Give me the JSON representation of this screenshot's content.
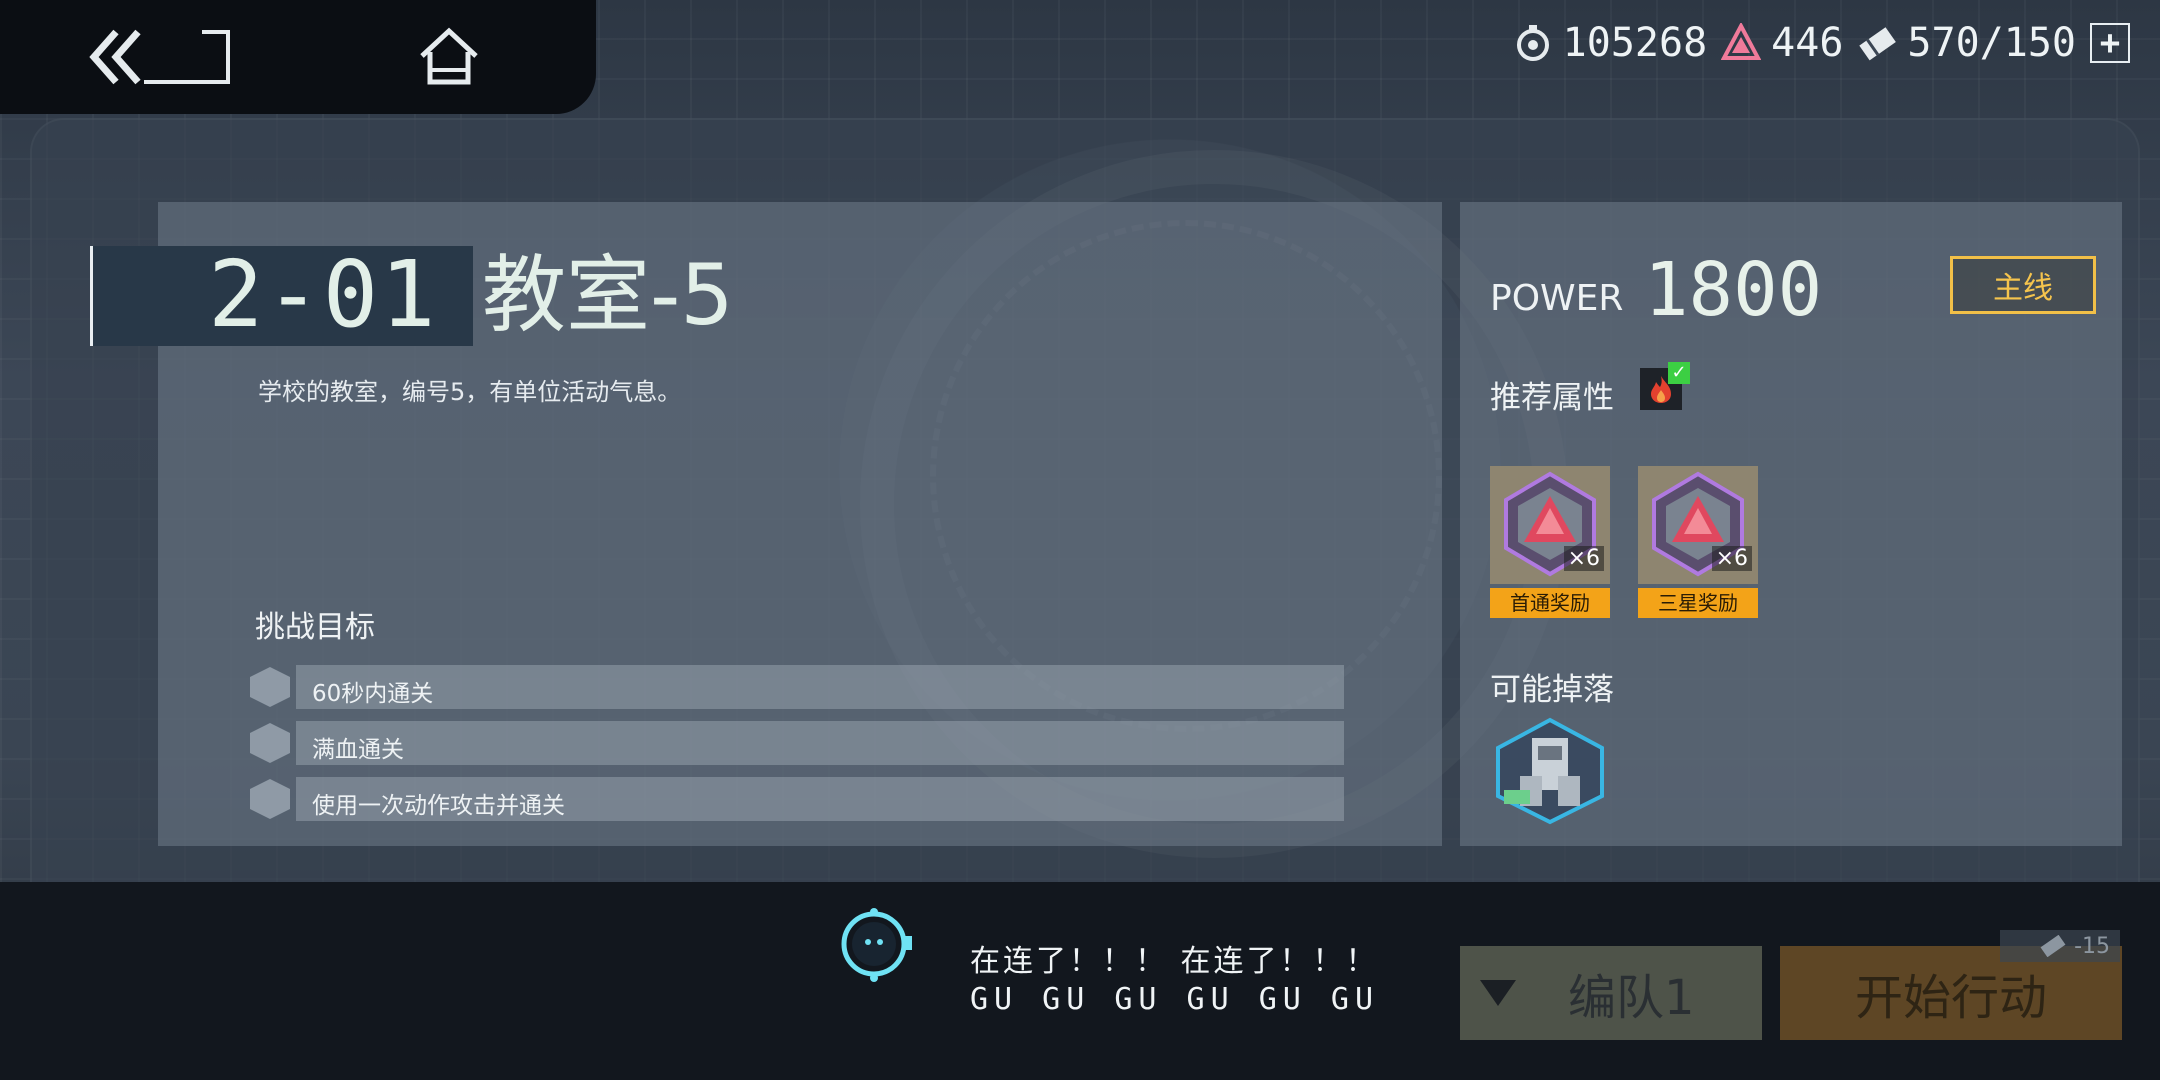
{
  "nav": {
    "back_icon": "double-chevron-back-icon",
    "home_icon": "home-icon"
  },
  "resources": {
    "coin": "105268",
    "gem": "446",
    "stamina": "570/150",
    "plus": "+"
  },
  "stage": {
    "id": "2-01",
    "name": "教室-5",
    "description": "学校的教室，编号5，有单位活动气息。",
    "objectives_title": "挑战目标",
    "objectives": [
      "60秒内通关",
      "满血通关",
      "使用一次动作攻击并通关"
    ]
  },
  "details": {
    "power_label": "POWER",
    "power_value": "1800",
    "route_badge": "主线",
    "recommended_label": "推荐属性",
    "recommended_attr_icon": "fire-icon",
    "rewards": [
      {
        "count": "×6",
        "tag": "首通奖励"
      },
      {
        "count": "×6",
        "tag": "三星奖励"
      }
    ],
    "drops_label": "可能掉落"
  },
  "footer": {
    "message_line1": "在连了！！！ 在连了！！！",
    "message_line2": "GU GU GU GU GU GU",
    "team_label": "编队1",
    "start_label": "开始行动",
    "cost": "-15"
  },
  "colors": {
    "accent_gold": "#f2c048",
    "reward_tag": "#f3a318",
    "check_green": "#3ccf43"
  }
}
